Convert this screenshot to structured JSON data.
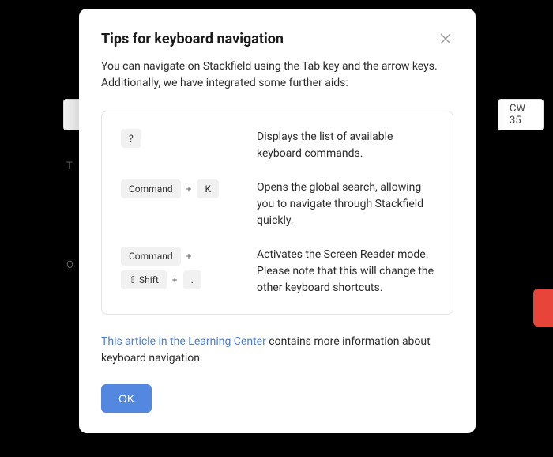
{
  "background": {
    "cw_label": "CW 35",
    "label_t": "T",
    "label_o": "O"
  },
  "modal": {
    "title": "Tips for keyboard navigation",
    "intro": "You can navigate on Stackfield using the Tab key and the arrow keys. Additionally, we have integrated some further aids:",
    "tips": [
      {
        "keys": [
          "?"
        ],
        "desc": "Displays the list of available keyboard commands."
      },
      {
        "keys": [
          "Command",
          "K"
        ],
        "desc": "Opens the global search, allowing you to navigate through Stackfield quickly."
      },
      {
        "keys": [
          "Command",
          "⇧ Shift",
          "."
        ],
        "desc": "Activates the Screen Reader mode. Please note that this will change the other keyboard shortcuts."
      }
    ],
    "footer": {
      "link_text": "This article in the Learning Center",
      "rest": " contains more information about keyboard navigation."
    },
    "ok_label": "OK"
  }
}
